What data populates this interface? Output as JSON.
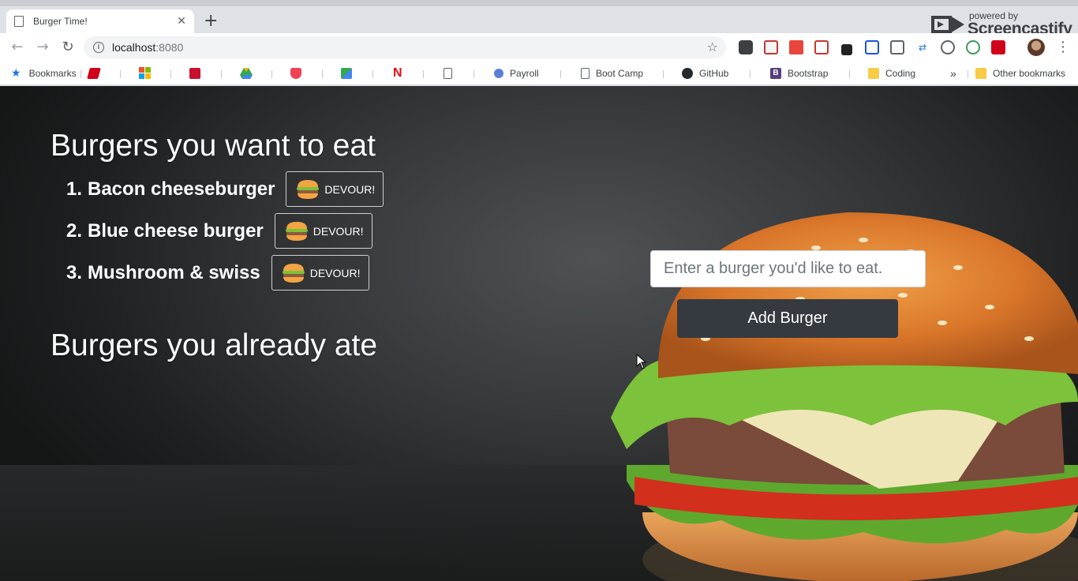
{
  "browser": {
    "tab_title": "Burger Time!",
    "url_host": "localhost",
    "url_port": ":8080",
    "watermark_powered": "powered by",
    "watermark_brand": "Screencastify"
  },
  "bookmarks": {
    "items": [
      {
        "label": "Bookmarks",
        "icon": "star-icon",
        "color": "#1a73e8"
      },
      {
        "label": "",
        "icon": "espn-icon",
        "color": "#d0021b"
      },
      {
        "label": "",
        "icon": "windows-icon",
        "color": "#f25022"
      },
      {
        "label": "",
        "icon": "stl-icon",
        "color": "#c8102e"
      },
      {
        "label": "",
        "icon": "google-drive-icon",
        "color": "#34a853"
      },
      {
        "label": "",
        "icon": "pocket-icon",
        "color": "#ef4056"
      },
      {
        "label": "",
        "icon": "google-maps-icon",
        "color": "#34a853"
      },
      {
        "label": "",
        "icon": "netflix-icon",
        "color": "#e50914"
      },
      {
        "label": "",
        "icon": "page-icon",
        "color": "#5f6368"
      },
      {
        "label": "Payroll",
        "icon": "circle-icon",
        "color": "#5b7fd6"
      },
      {
        "label": "Boot Camp",
        "icon": "page-icon",
        "color": "#5f6368"
      },
      {
        "label": "GitHub",
        "icon": "github-icon",
        "color": "#24292e"
      },
      {
        "label": "Bootstrap",
        "icon": "bootstrap-icon",
        "color": "#563d7c"
      },
      {
        "label": "Coding",
        "icon": "folder-icon",
        "color": "#f9cb47"
      }
    ],
    "overflow": "»",
    "other_label": "Other bookmarks"
  },
  "app": {
    "want_heading": "Burgers you want to eat",
    "ate_heading": "Burgers you already ate",
    "burgers": [
      {
        "num": "1.",
        "name": "Bacon cheeseburger",
        "button": "DEVOUR!"
      },
      {
        "num": "2.",
        "name": "Blue cheese burger",
        "button": "DEVOUR!"
      },
      {
        "num": "3.",
        "name": "Mushroom & swiss",
        "button": "DEVOUR!"
      }
    ],
    "input_placeholder": "Enter a burger you'd like to eat.",
    "add_button": "Add Burger"
  },
  "colors": {
    "button_dark": "#343a40",
    "text_white": "#ffffff"
  }
}
